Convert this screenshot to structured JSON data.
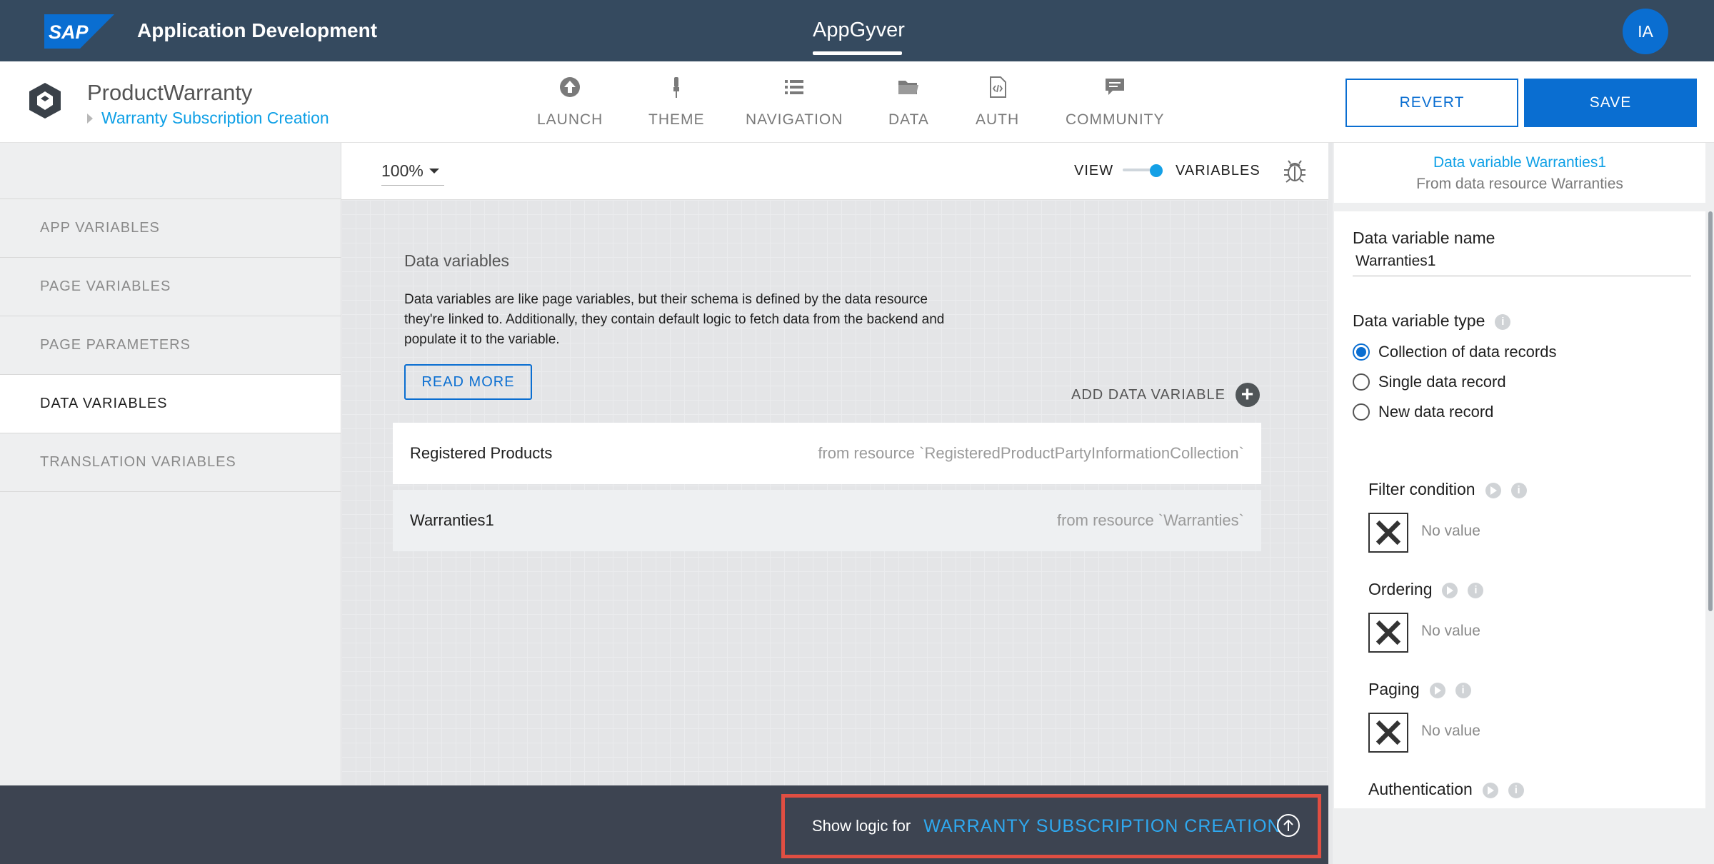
{
  "shell": {
    "title": "Application Development",
    "center_tab": "AppGyver",
    "avatar_initials": "IA",
    "brand_color": "#354a5f"
  },
  "app": {
    "name": "ProductWarranty",
    "page": "Warranty Subscription Creation",
    "nav": [
      {
        "label": "LAUNCH",
        "icon": "upload-circle-icon"
      },
      {
        "label": "THEME",
        "icon": "brush-icon"
      },
      {
        "label": "NAVIGATION",
        "icon": "list-icon"
      },
      {
        "label": "DATA",
        "icon": "folder-icon"
      },
      {
        "label": "AUTH",
        "icon": "code-file-icon"
      },
      {
        "label": "COMMUNITY",
        "icon": "chat-icon"
      }
    ],
    "revert_label": "REVERT",
    "save_label": "SAVE",
    "accent_color": "#0a6ed1"
  },
  "sidebar": {
    "items": [
      {
        "label": "APP VARIABLES"
      },
      {
        "label": "PAGE VARIABLES"
      },
      {
        "label": "PAGE PARAMETERS"
      },
      {
        "label": "DATA VARIABLES"
      },
      {
        "label": "TRANSLATION VARIABLES"
      }
    ],
    "active": "DATA VARIABLES"
  },
  "toolbar": {
    "zoom": "100%",
    "view_label": "VIEW",
    "variables_label": "VARIABLES"
  },
  "main": {
    "heading": "Data variables",
    "description": "Data variables are like page variables, but their schema is defined by the data resource they're linked to. Additionally, they contain default logic to fetch data from the backend and populate it to the variable.",
    "read_more": "READ MORE",
    "add_label": "ADD DATA VARIABLE",
    "rows": [
      {
        "name": "Registered Products",
        "resource": "from resource `RegisteredProductPartyInformationCollection`"
      },
      {
        "name": "Warranties1",
        "resource": "from resource `Warranties`"
      }
    ]
  },
  "bottom": {
    "show_logic_label": "Show logic for",
    "page_name": "WARRANTY SUBSCRIPTION CREATION"
  },
  "panel": {
    "title": "Data variable Warranties1",
    "subtitle": "From data resource Warranties",
    "name_label": "Data variable name",
    "name_value": "Warranties1",
    "type_label": "Data variable type",
    "types": [
      {
        "label": "Collection of data records",
        "selected": true
      },
      {
        "label": "Single data record",
        "selected": false
      },
      {
        "label": "New data record",
        "selected": false
      }
    ],
    "filter_label": "Filter condition",
    "ordering_label": "Ordering",
    "paging_label": "Paging",
    "auth_label": "Authentication",
    "no_value": "No value"
  }
}
